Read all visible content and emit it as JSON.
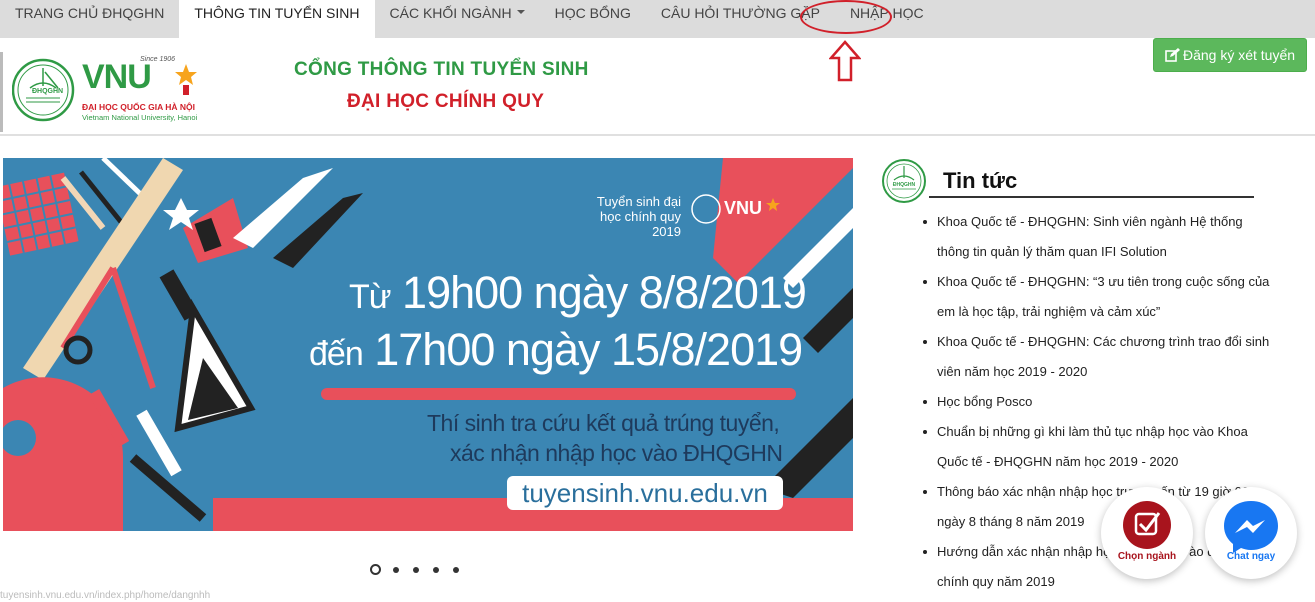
{
  "nav": {
    "items": [
      {
        "label": "TRANG CHỦ ĐHQGHN"
      },
      {
        "label": "THÔNG TIN TUYỂN SINH"
      },
      {
        "label": "CÁC KHỐI NGÀNH"
      },
      {
        "label": "HỌC BỔNG"
      },
      {
        "label": "CÂU HỎI THƯỜNG GẶP"
      },
      {
        "label": "NHẬP HỌC"
      }
    ],
    "active_index": 1
  },
  "header": {
    "portal_title": "CỔNG THÔNG TIN TUYỂN SINH",
    "portal_subtitle": "ĐẠI HỌC CHÍNH QUY",
    "register_button": "Đăng ký xét tuyển",
    "logo": {
      "wordmark": "VNU",
      "since": "Since 1906",
      "seal_text": "ĐHQGHN",
      "name_vi": "ĐẠI HỌC QUỐC GIA HÀ NỘI",
      "name_en": "Vietnam National University, Hanoi"
    }
  },
  "banner": {
    "top_note": "Tuyển sinh đại học chính quy 2019",
    "line1_prefix": "Từ",
    "line1_main": "19h00 ngày 8/8/2019",
    "line2_prefix": "đến",
    "line2_main": "17h00 ngày 15/8/2019",
    "desc1": "Thí sinh tra cứu kết quả trúng tuyển,",
    "desc2": "xác nhận nhập học vào ĐHQGHN",
    "url": "tuyensinh.vnu.edu.vn",
    "slide_count": 5,
    "active_slide": 1
  },
  "news": {
    "title": "Tin tức",
    "items": [
      "Khoa Quốc tế - ĐHQGHN: Sinh viên ngành Hệ thống thông tin quản lý thăm quan IFI Solution",
      "Khoa Quốc tế - ĐHQGHN: “3 ưu tiên trong cuộc sống của em là học tập, trải nghiệm và cảm xúc”",
      "Khoa Quốc tế - ĐHQGHN: Các chương trình trao đổi sinh viên năm học 2019 - 2020",
      "Học bổng Posco",
      "Chuẩn bị những gì khi làm thủ tục nhập học vào Khoa Quốc tế - ĐHQGHN năm học 2019 - 2020",
      "Thông báo xác nhận nhập học trực tuyến từ 19 giờ 00 ngày 8 tháng 8 năm 2019",
      "Hướng dẫn xác nhận nhập học trực tuyến vào đại học chính quy năm 2019"
    ]
  },
  "floating": {
    "choose_label": "Chọn ngành",
    "chat_label": "Chat ngay"
  },
  "status_url": "tuyensinh.vnu.edu.vn/index.php/home/dangnhh",
  "colors": {
    "green": "#2f9a45",
    "red": "#d1202a",
    "button_green": "#5cb85c",
    "banner_blue": "#3b86b3"
  }
}
